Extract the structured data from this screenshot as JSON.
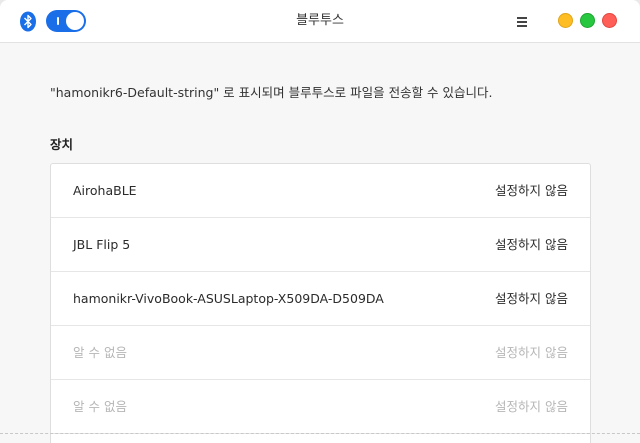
{
  "header": {
    "title": "블루투스",
    "bluetooth_icon": "bluetooth-icon",
    "toggle_state": "on",
    "accent": "#1a6ee8"
  },
  "description": "\"hamonikr6-Default-string\" 로 표시되며 블루투스로 파일을 전송할 수 있습니다.",
  "devices_section": {
    "title": "장치",
    "devices": [
      {
        "name": "AirohaBLE",
        "status": "설정하지 않음"
      },
      {
        "name": "JBL Flip 5",
        "status": "설정하지 않음"
      },
      {
        "name": "hamonikr-VivoBook-ASUSLaptop-X509DA-D509DA",
        "status": "설정하지 않음"
      },
      {
        "name": "알 수 없음",
        "status": "설정하지 않음"
      },
      {
        "name": "알 수 없음",
        "status": "설정하지 않음"
      }
    ]
  }
}
